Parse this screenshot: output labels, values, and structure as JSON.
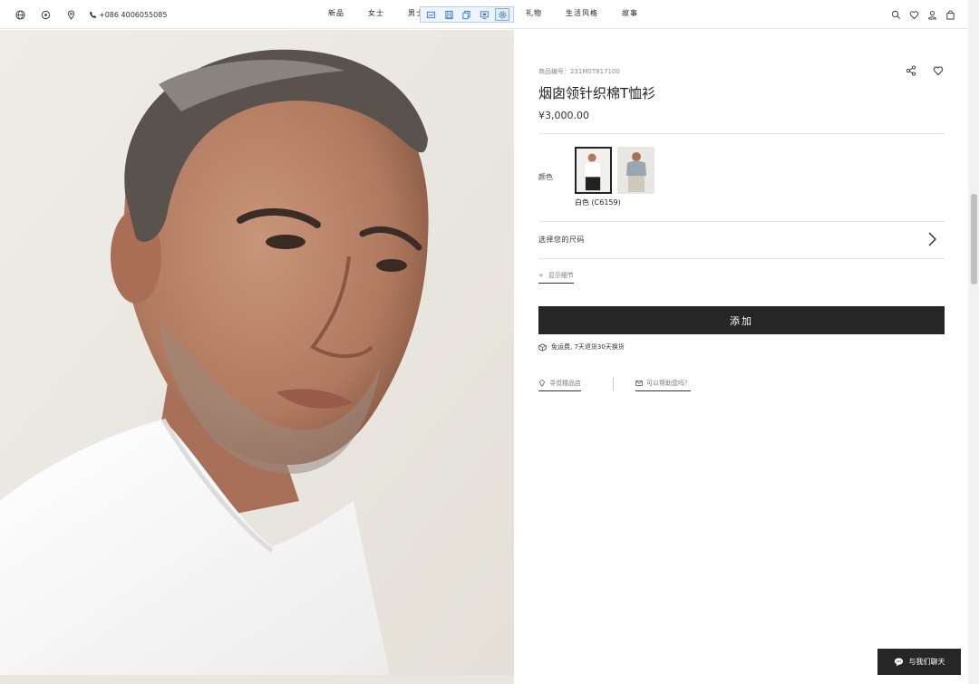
{
  "header": {
    "phone": "+086 4006055085",
    "nav": [
      "新品",
      "女士",
      "男士",
      "礼物",
      "生活风格",
      "故事"
    ]
  },
  "product": {
    "sku": "商品编号：231M0T817100",
    "title": "烟囱领针织棉T恤衫",
    "price": "¥3,000.00",
    "color_label": "颜色",
    "color_name": "白色 (C6159)",
    "size_label": "选择您的尺码",
    "details_link": "显示细节",
    "add_button": "添加",
    "shipping": "免运费, 7天退货30天换货",
    "store_link": "寻觅精品店",
    "help_link": "可以帮助您吗？"
  },
  "chat": {
    "label": "与我们聊天"
  },
  "colors": {
    "accent": "#262626",
    "toolbar_border": "#b9d0ea"
  }
}
